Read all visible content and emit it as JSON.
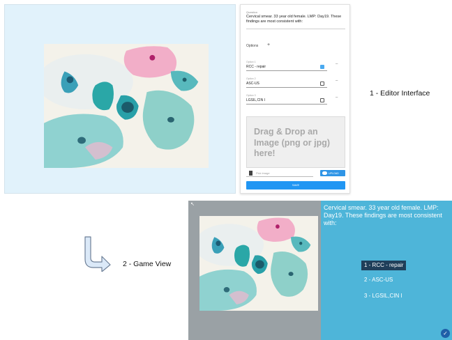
{
  "editor": {
    "question_label": "Question",
    "question_text": "Cervical smear. 33 year old female. LMP: Day19. These findings are most consistent with:",
    "options_title": "Options",
    "add_symbol": "+",
    "options": [
      {
        "label": "Option 1",
        "value": "RCC - repair",
        "checked": true
      },
      {
        "label": "Option 2",
        "value": "ASC-US",
        "checked": false
      },
      {
        "label": "Option 3",
        "value": "LGSIL,CIN I",
        "checked": false
      }
    ],
    "delete_symbol": "–",
    "dropzone_text": "Drag & Drop an Image (png or jpg) here!",
    "file_placeholder": "Pick image",
    "upload_label": "UPLOAD",
    "save_label": "SAVE"
  },
  "labels": {
    "editor_interface": "1 - Editor Interface",
    "game_view": "2 - Game View"
  },
  "game": {
    "corner_glyph": "↖",
    "question_text": "Cervical smear. 33 year old female. LMP: Day19. These findings are most consistent with:",
    "answers": [
      {
        "text": "1 - RCC - repair",
        "selected": true
      },
      {
        "text": "2 - ASC-US",
        "selected": false
      },
      {
        "text": "3 - LGSIL,CIN I",
        "selected": false
      }
    ],
    "confirm_icon": "✓"
  },
  "colors": {
    "editor_canvas": "#e1f2fb",
    "game_background": "#4eb5d9",
    "selected_answer": "#1f3f5a",
    "primary_button": "#2196f3"
  }
}
